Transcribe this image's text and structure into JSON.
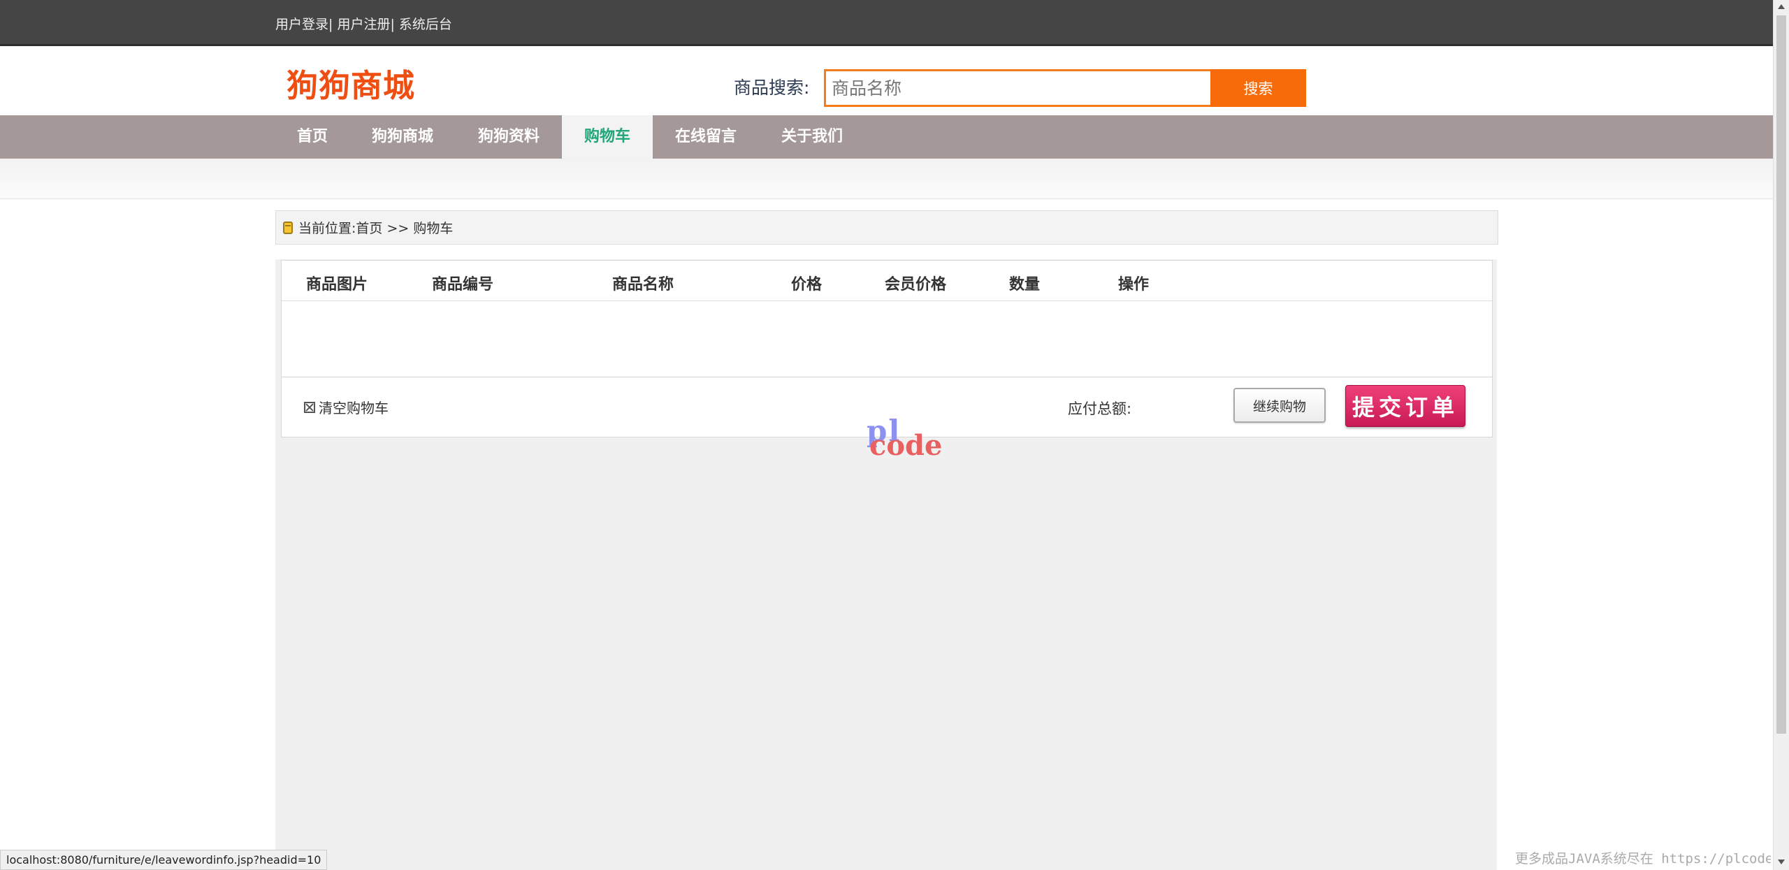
{
  "topbar": {
    "login": "用户登录|",
    "register": " 用户注册|",
    "admin": " 系统后台"
  },
  "header": {
    "logo": "狗狗商城",
    "search_label": "商品搜索:",
    "search_placeholder": "商品名称",
    "search_button": "搜索"
  },
  "nav": {
    "items": [
      {
        "label": "首页"
      },
      {
        "label": "狗狗商城"
      },
      {
        "label": "狗狗资料"
      },
      {
        "label": "购物车",
        "active": true
      },
      {
        "label": "在线留言"
      },
      {
        "label": "关于我们"
      }
    ]
  },
  "breadcrumb": {
    "text": "当前位置:首页 >> 购物车"
  },
  "cart": {
    "columns": [
      "商品图片",
      "商品编号",
      "商品名称",
      "价格",
      "会员价格",
      "数量",
      "操作"
    ],
    "clear_label": "清空购物车",
    "total_label": "应付总额:",
    "continue_label": "继续购物",
    "submit_label": "提交订单"
  },
  "watermark": {
    "pl": "pl",
    "code": "code"
  },
  "status": {
    "url": "localhost:8080/furniture/e/leavewordinfo.jsp?headid=10"
  },
  "footer": {
    "note": "更多成品JAVA系统尽在 https://plcode.vip"
  }
}
